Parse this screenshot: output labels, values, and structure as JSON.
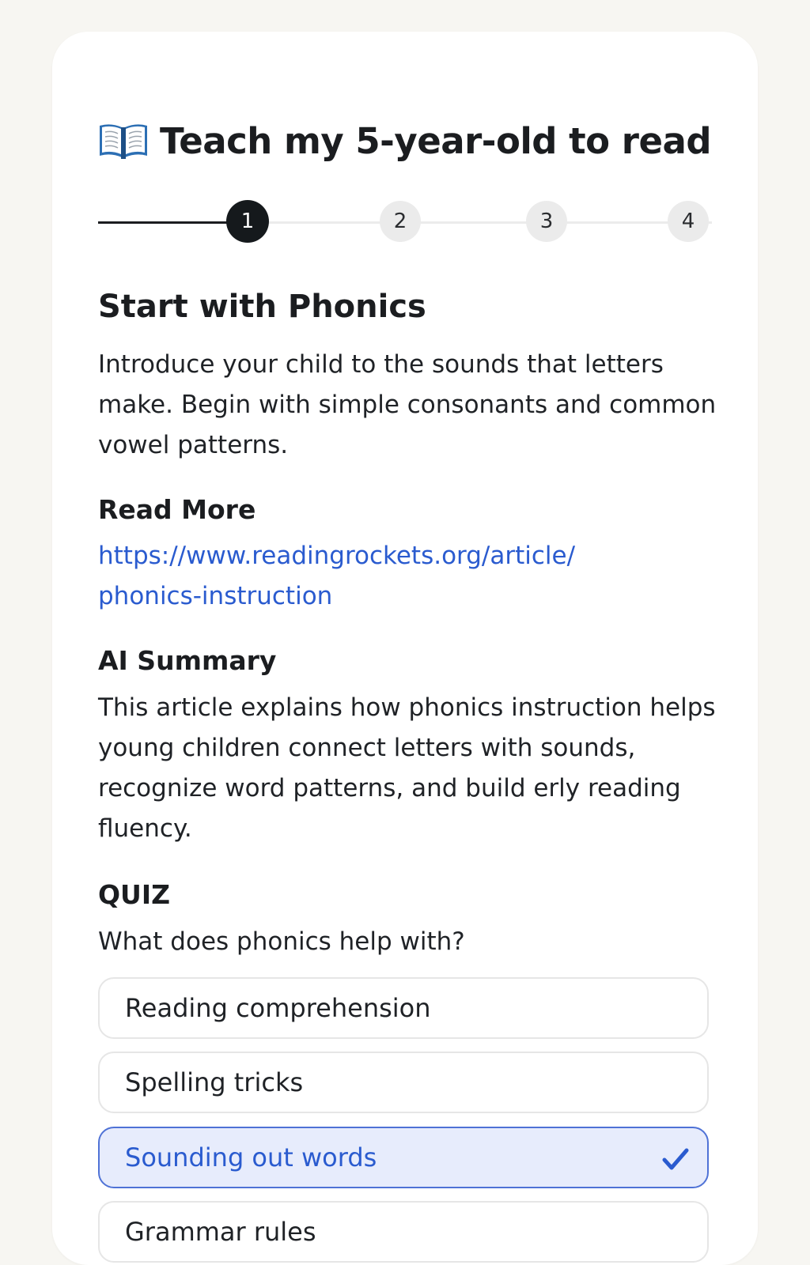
{
  "page": {
    "title": "Teach my 5-year-old to read",
    "title_icon": "open-book-icon"
  },
  "stepper": {
    "steps": [
      "1",
      "2",
      "3",
      "4"
    ],
    "current": 1
  },
  "lesson": {
    "heading": "Start with Phonics",
    "description": "Introduce your child to the sounds that letters make. Begin with simple consonants and common vowel patterns."
  },
  "read_more": {
    "heading": "Read More",
    "url_line1": "https://www.readingrockets.org/article/",
    "url_line2": "phonics-instruction"
  },
  "ai_summary": {
    "heading": "AI Summary",
    "text": "This article explains how phonics instruction helps young children connect letters with sounds, recognize word patterns, and build erly reading fluency."
  },
  "quiz": {
    "heading": "QUIZ",
    "question": "What does phonics help with?",
    "options": [
      {
        "label": "Reading comprehension",
        "selected": false
      },
      {
        "label": "Spelling tricks",
        "selected": false
      },
      {
        "label": "Sounding out words",
        "selected": true
      },
      {
        "label": "Grammar rules",
        "selected": false
      }
    ]
  },
  "colors": {
    "background": "#f7f6f2",
    "card": "#ffffff",
    "text": "#1b1d20",
    "link": "#2a5bcf",
    "selected_bg": "#e7ecfc",
    "selected_border": "#4f72d6",
    "step_active": "#15191c",
    "step_inactive": "#ebebeb"
  }
}
